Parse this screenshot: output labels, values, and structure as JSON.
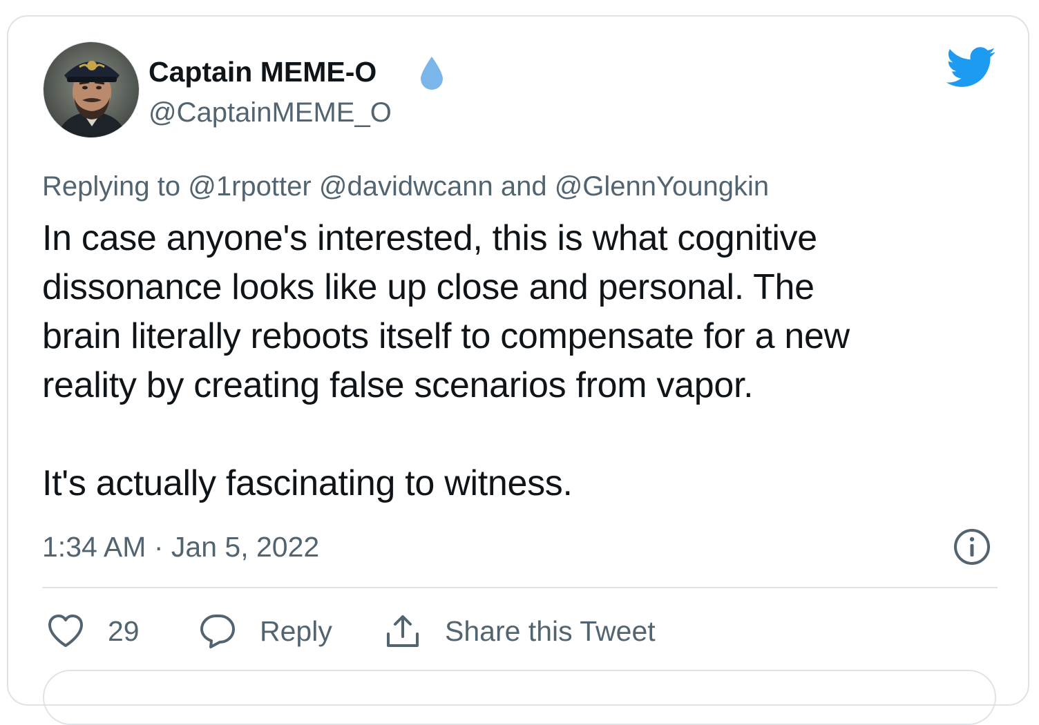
{
  "author": {
    "display_name": "Captain MEME-O",
    "handle": "@CaptainMEME_O",
    "badge_icon": "water-drop-icon",
    "avatar": "captain-portrait"
  },
  "brand_icon": "twitter-bird-icon",
  "reply_context": {
    "prefix": "Replying to",
    "mentions": [
      "@1rpotter",
      "@davidwcann",
      "@GlennYoungkin"
    ],
    "joiner": "and"
  },
  "tweet": {
    "text": "In case anyone's interested, this is what cognitive\ndissonance looks like up close and personal.  The\nbrain literally reboots itself to compensate for a new\nreality by creating false scenarios from vapor.\n\nIt's actually fascinating to witness.",
    "time": "1:34 AM",
    "date": "Jan 5, 2022",
    "separator": "·"
  },
  "actions": {
    "like_count": "29",
    "reply_label": "Reply",
    "share_label": "Share this Tweet"
  },
  "colors": {
    "accent": "#1d9bf0",
    "badge": "#7ab6ea",
    "secondary_text": "#536471",
    "primary_text": "#0f1419",
    "border": "#dfe3e6"
  }
}
